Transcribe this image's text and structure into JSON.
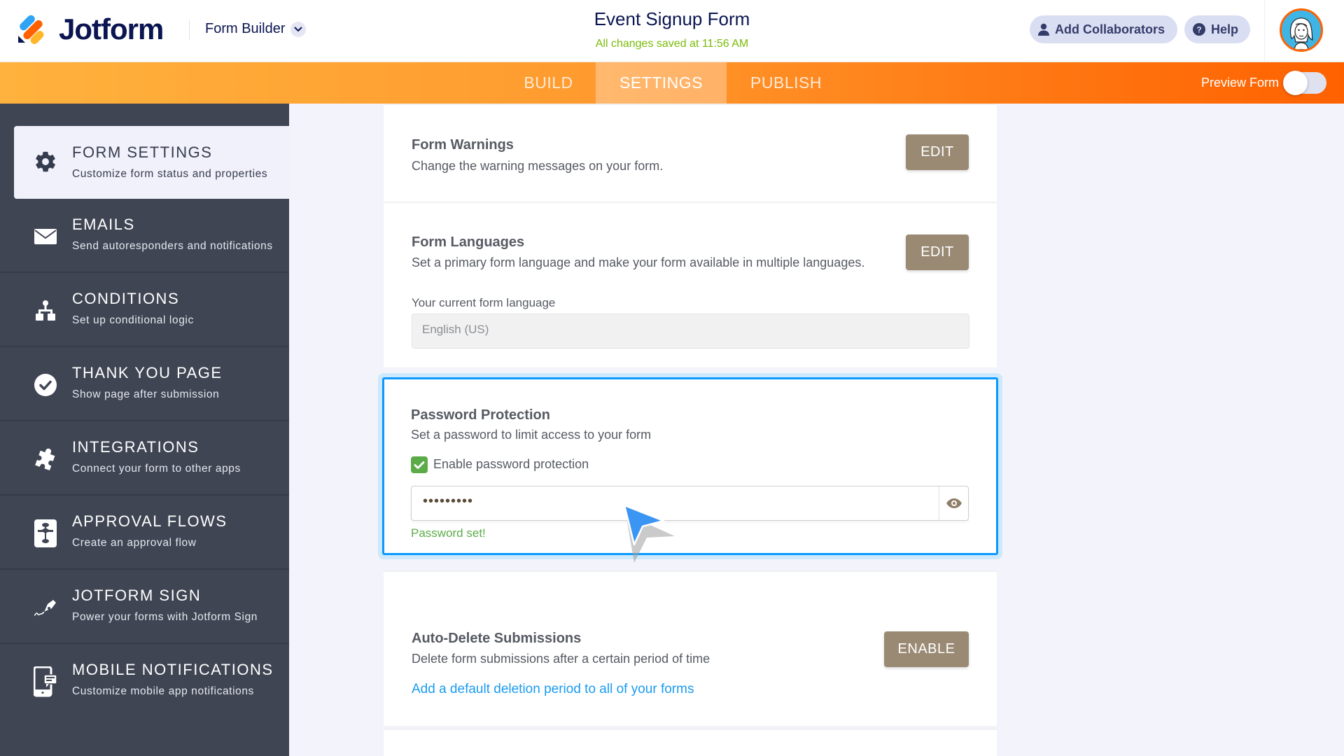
{
  "header": {
    "brand": "Jotform",
    "builder_label": "Form Builder",
    "form_title": "Event Signup Form",
    "save_status": "All changes saved at 11:56 AM",
    "add_collaborators_label": "Add Collaborators",
    "help_label": "Help",
    "avatar_alt": "User avatar"
  },
  "nav": {
    "tabs": [
      {
        "label": "BUILD",
        "active": false
      },
      {
        "label": "SETTINGS",
        "active": true
      },
      {
        "label": "PUBLISH",
        "active": false
      }
    ],
    "preview_label": "Preview Form",
    "preview_enabled": false
  },
  "sidebar": {
    "items": [
      {
        "icon": "gear-icon",
        "title": "FORM SETTINGS",
        "desc": "Customize form status and properties",
        "active": true
      },
      {
        "icon": "envelope-icon",
        "title": "EMAILS",
        "desc": "Send autoresponders and notifications",
        "active": false
      },
      {
        "icon": "flowchart-icon",
        "title": "CONDITIONS",
        "desc": "Set up conditional logic",
        "active": false
      },
      {
        "icon": "check-circle-icon",
        "title": "THANK YOU PAGE",
        "desc": "Show page after submission",
        "active": false
      },
      {
        "icon": "puzzle-icon",
        "title": "INTEGRATIONS",
        "desc": "Connect your form to other apps",
        "active": false
      },
      {
        "icon": "approval-flow-icon",
        "title": "APPROVAL FLOWS",
        "desc": "Create an approval flow",
        "active": false
      },
      {
        "icon": "pen-sign-icon",
        "title": "JOTFORM SIGN",
        "desc": "Power your forms with Jotform Sign",
        "active": false
      },
      {
        "icon": "mobile-notification-icon",
        "title": "MOBILE NOTIFICATIONS",
        "desc": "Customize mobile app notifications",
        "active": false
      }
    ]
  },
  "content": {
    "form_warnings": {
      "title": "Form Warnings",
      "desc": "Change the warning messages on your form.",
      "button": "EDIT"
    },
    "form_languages": {
      "title": "Form Languages",
      "desc": "Set a primary form language and make your form available in multiple languages.",
      "button": "EDIT",
      "current_label": "Your current form language",
      "current_value": "English (US)"
    },
    "password_protection": {
      "title": "Password Protection",
      "desc": "Set a password to limit access to your form",
      "checkbox_label": "Enable password protection",
      "checked": true,
      "password_masked": "•••••••••",
      "status": "Password set!"
    },
    "auto_delete": {
      "title": "Auto-Delete Submissions",
      "desc": "Delete form submissions after a certain period of time",
      "button": "ENABLE",
      "link": "Add a default deletion period to all of your forms"
    }
  },
  "colors": {
    "brand_navy": "#0a1551",
    "brand_orange": "#ff6100",
    "save_green": "#78bb07",
    "sidebar_bg": "#3f4553",
    "button_brown": "#9a8a74",
    "focus_blue": "#0a99ff",
    "success_green": "#5cab49",
    "link_blue": "#1a9bf1"
  }
}
